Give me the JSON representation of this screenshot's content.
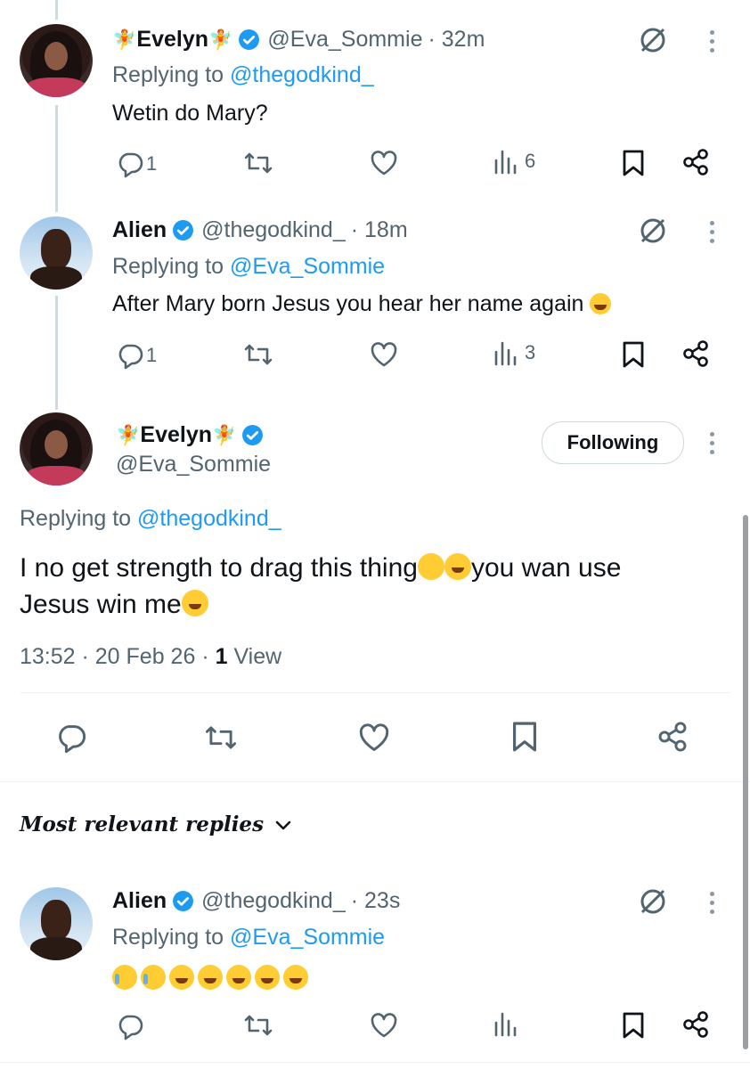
{
  "thread": [
    {
      "name": "Evelyn",
      "handle": "@Eva_Sommie",
      "time": "· 32m",
      "replying_label": "Replying to",
      "replying_to": "@thegodkind_",
      "text": "Wetin do Mary?",
      "replies": "1",
      "views": "6"
    },
    {
      "name": "Alien",
      "handle": "@thegodkind_",
      "time": "· 18m",
      "replying_label": "Replying to",
      "replying_to": "@Eva_Sommie",
      "text": "After Mary born Jesus you hear her name again",
      "replies": "1",
      "views": "3"
    }
  ],
  "main": {
    "name": "Evelyn",
    "handle": "@Eva_Sommie",
    "follow_label": "Following",
    "replying_label": "Replying to",
    "replying_to": "@thegodkind_",
    "text_line1": "I no get strength to drag this thing",
    "text_line1b": "you wan use",
    "text_line2": "Jesus win me",
    "meta_time": "13:52",
    "meta_date": "20 Feb 26",
    "meta_views_count": "1",
    "meta_views_label": "View"
  },
  "replies_header": {
    "label": "Most relevant replies"
  },
  "reply": {
    "name": "Alien",
    "handle": "@thegodkind_",
    "time": "· 23s",
    "replying_label": "Replying to",
    "replying_to": "@Eva_Sommie"
  },
  "colors": {
    "accent": "#1d9bf0",
    "muted": "#536471",
    "text": "#0f1419",
    "divider": "#eff3f4"
  },
  "icons": [
    "reply-icon",
    "retweet-icon",
    "like-icon",
    "views-icon",
    "bookmark-icon",
    "share-icon",
    "grok-icon",
    "more-icon",
    "verified-icon",
    "chevron-down-icon"
  ]
}
